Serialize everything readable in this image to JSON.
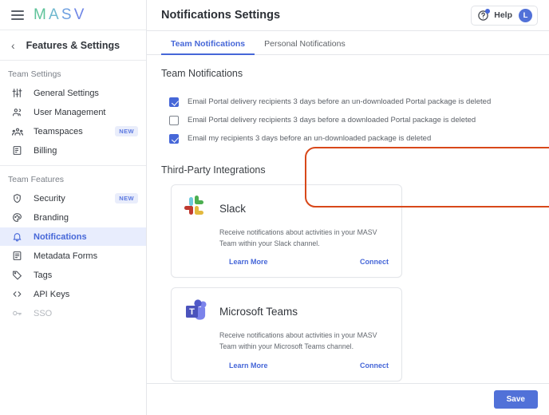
{
  "sidebar": {
    "logo": {
      "letters": [
        "M",
        "A",
        "S",
        "V"
      ],
      "name": "MASV"
    },
    "back_label": "Features & Settings",
    "groups": [
      {
        "title": "Team Settings",
        "items": [
          {
            "label": "General Settings",
            "icon": "sliders-icon",
            "badge": "",
            "active": false,
            "disabled": false
          },
          {
            "label": "User Management",
            "icon": "users-icon",
            "badge": "",
            "active": false,
            "disabled": false
          },
          {
            "label": "Teamspaces",
            "icon": "group-icon",
            "badge": "NEW",
            "active": false,
            "disabled": false
          },
          {
            "label": "Billing",
            "icon": "receipt-icon",
            "badge": "",
            "active": false,
            "disabled": false
          }
        ]
      },
      {
        "title": "Team Features",
        "items": [
          {
            "label": "Security",
            "icon": "shield-icon",
            "badge": "NEW",
            "active": false,
            "disabled": false
          },
          {
            "label": "Branding",
            "icon": "palette-icon",
            "badge": "",
            "active": false,
            "disabled": false
          },
          {
            "label": "Notifications",
            "icon": "bell-icon",
            "badge": "",
            "active": true,
            "disabled": false
          },
          {
            "label": "Metadata Forms",
            "icon": "form-icon",
            "badge": "",
            "active": false,
            "disabled": false
          },
          {
            "label": "Tags",
            "icon": "tag-icon",
            "badge": "",
            "active": false,
            "disabled": false
          },
          {
            "label": "API Keys",
            "icon": "code-icon",
            "badge": "",
            "active": false,
            "disabled": false
          },
          {
            "label": "SSO",
            "icon": "key-icon",
            "badge": "",
            "active": false,
            "disabled": true
          }
        ]
      }
    ]
  },
  "header": {
    "title": "Notifications Settings",
    "help_label": "Help",
    "avatar_initial": "L"
  },
  "tabs": [
    {
      "label": "Team Notifications",
      "active": true
    },
    {
      "label": "Personal Notifications",
      "active": false
    }
  ],
  "sections": {
    "team_notifications_title": "Team Notifications",
    "integrations_title": "Third-Party Integrations"
  },
  "checkboxes": [
    {
      "checked": true,
      "label": "Email Portal delivery recipients 3 days before an un-downloaded Portal package is deleted"
    },
    {
      "checked": false,
      "label": "Email Portal delivery recipients 3 days before a downloaded Portal package is deleted"
    },
    {
      "checked": true,
      "label": "Email my recipients 3 days before an un-downloaded package is deleted"
    }
  ],
  "integrations": [
    {
      "name": "Slack",
      "logo": "slack-logo",
      "description": "Receive notifications about activities in your MASV Team within your Slack channel.",
      "learn_more": "Learn More",
      "connect": "Connect"
    },
    {
      "name": "Microsoft Teams",
      "logo": "microsoft-teams-logo",
      "description": "Receive notifications about activities in your MASV Team within your Microsoft Teams channel.",
      "learn_more": "Learn More",
      "connect": "Connect"
    }
  ],
  "footer": {
    "save_label": "Save"
  },
  "colors": {
    "accent": "#4667d8",
    "save_button": "#5171d8",
    "annotation": "#d8481a",
    "active_item_bg": "#e8edfd",
    "badge_text": "#5b78e0"
  }
}
